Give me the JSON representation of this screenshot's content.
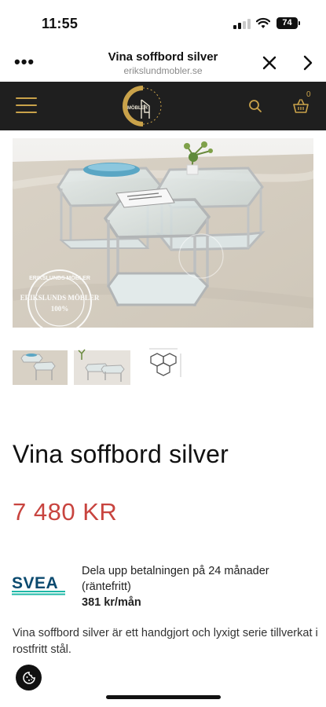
{
  "status_bar": {
    "time": "11:55",
    "battery": "74"
  },
  "browser": {
    "page_title": "Vina soffbord silver",
    "domain": "erikslundmobler.se"
  },
  "site_header": {
    "logo_text": "MÖBLER",
    "cart_count": "0"
  },
  "hero_watermark": {
    "top": "ERIKSLUNDS MÖBLER",
    "middle": "ERIKSLUNDS MÖBLER",
    "bottom": "100%"
  },
  "product": {
    "title": "Vina soffbord silver",
    "price": "7 480 KR",
    "description": "Vina soffbord silver är ett handgjort och lyxigt serie tillverkat i rostfritt stål."
  },
  "financing": {
    "provider_logo": "SVEA",
    "line1": "Dela upp betalningen på 24 månader",
    "line2": "(räntefritt)",
    "monthly": "381 kr/mån"
  },
  "thumbnails": [
    "thumbnail-1",
    "thumbnail-2",
    "thumbnail-3"
  ],
  "colors": {
    "header_bg": "#1f1f1f",
    "gold": "#c9a24a",
    "price": "#c8443f",
    "svea_blue": "#0b4a6f",
    "svea_teal": "#1fb9a7"
  }
}
